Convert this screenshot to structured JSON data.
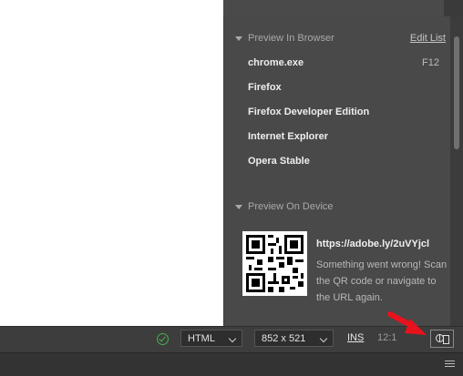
{
  "preview_panel": {
    "browser_section_title": "Preview In Browser",
    "edit_list_label": "Edit List",
    "browsers": [
      {
        "name": "chrome.exe",
        "shortcut": "F12"
      },
      {
        "name": "Firefox",
        "shortcut": ""
      },
      {
        "name": "Firefox Developer Edition",
        "shortcut": ""
      },
      {
        "name": "Internet Explorer",
        "shortcut": ""
      },
      {
        "name": "Opera Stable",
        "shortcut": ""
      }
    ],
    "device_section_title": "Preview On Device",
    "device_url": "https://adobe.ly/2uVYjcl",
    "device_message": "Something went wrong! Scan the QR code or navigate to the URL again."
  },
  "statusbar": {
    "doc_type": "HTML",
    "window_size": "852 x 521",
    "insert_mode": "INS",
    "cursor_position": "12:1"
  },
  "icons": {
    "status": "check-circle-icon",
    "preview_button": "device-preview-icon",
    "menu": "hamburger-icon",
    "annotation": "red-arrow"
  },
  "colors": {
    "status_ok": "#49b04b",
    "annotation_arrow": "#e8121c"
  }
}
